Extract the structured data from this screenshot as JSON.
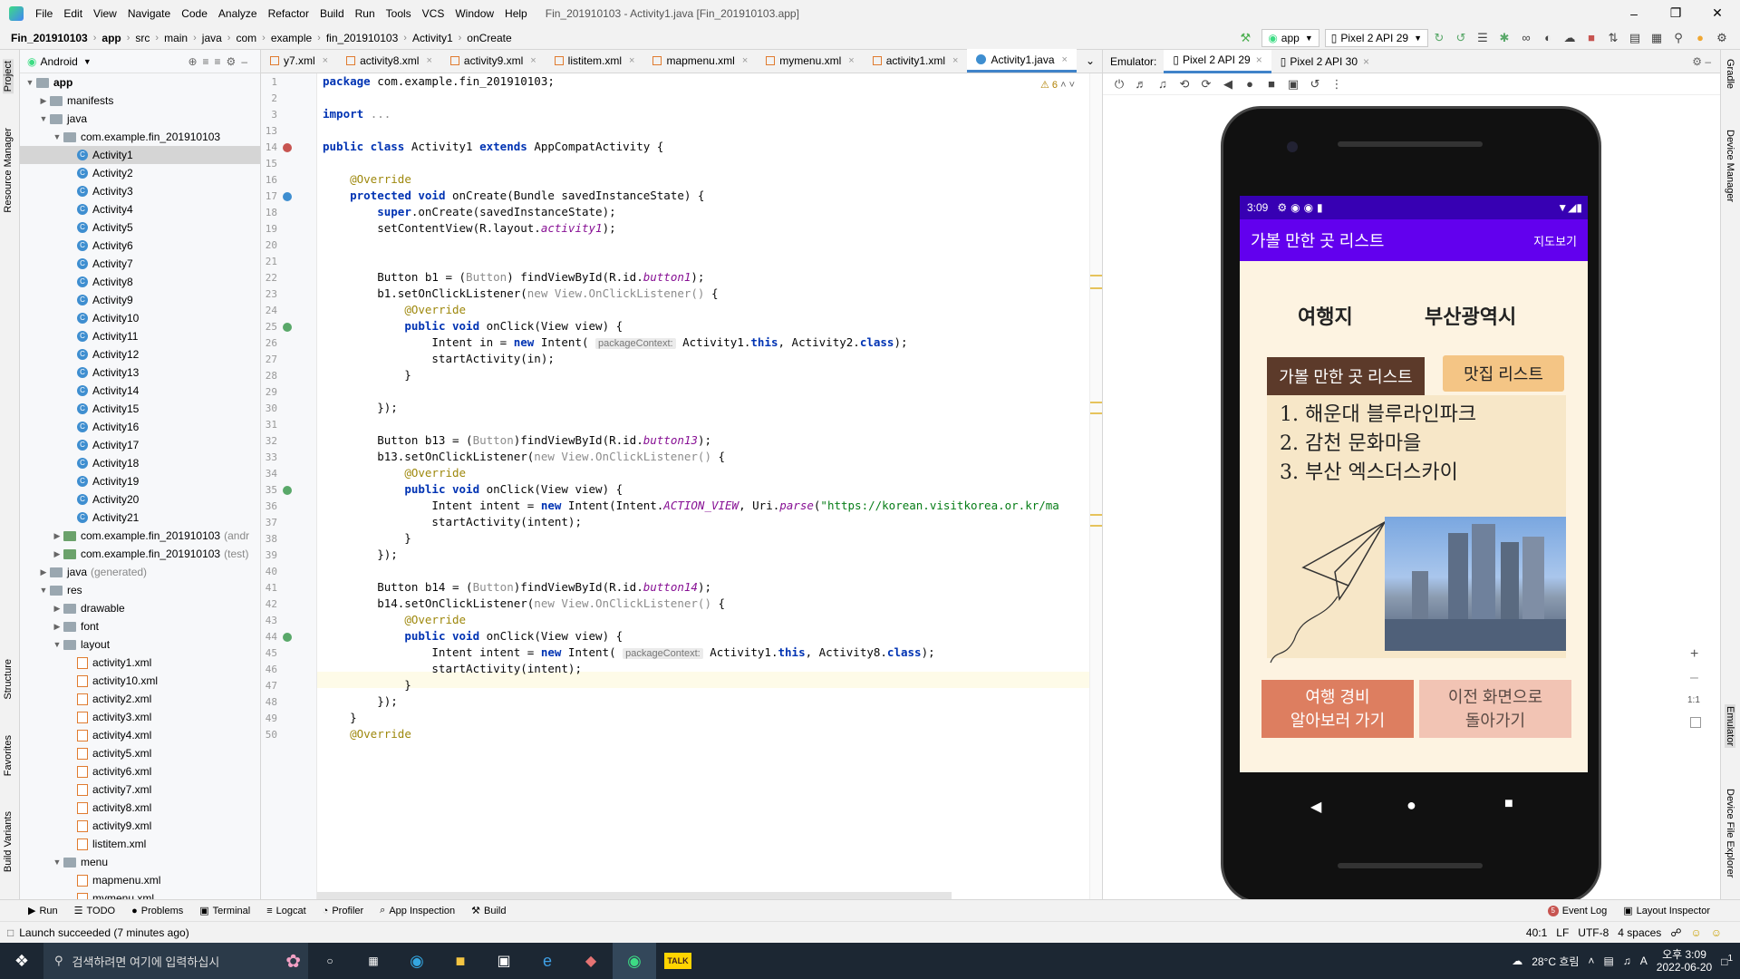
{
  "menubar": {
    "items": [
      "File",
      "Edit",
      "View",
      "Navigate",
      "Code",
      "Analyze",
      "Refactor",
      "Build",
      "Run",
      "Tools",
      "VCS",
      "Window",
      "Help"
    ],
    "title": "Fin_201910103 - Activity1.java [Fin_201910103.app]"
  },
  "navbar": {
    "crumbs": [
      "Fin_201910103",
      "app",
      "src",
      "main",
      "java",
      "com",
      "example",
      "fin_201910103",
      "Activity1",
      "onCreate"
    ],
    "run_config": "app",
    "device": "Pixel 2 API 29"
  },
  "left_strip": {
    "project": "Project",
    "resource_manager": "Resource Manager",
    "structure": "Structure",
    "favorites": "Favorites",
    "build_variants": "Build Variants"
  },
  "right_strip": {
    "gradle": "Gradle",
    "device_manager": "Device Manager",
    "emulator": "Emulator",
    "device_file_explorer": "Device File Explorer"
  },
  "project": {
    "view_mode": "Android",
    "tree": [
      {
        "label": "app",
        "depth": 0,
        "type": "folder",
        "open": true,
        "bold": true
      },
      {
        "label": "manifests",
        "depth": 1,
        "type": "folder"
      },
      {
        "label": "java",
        "depth": 1,
        "type": "folder",
        "open": true
      },
      {
        "label": "com.example.fin_201910103",
        "depth": 2,
        "type": "folder",
        "open": true
      },
      {
        "label": "Activity1",
        "depth": 3,
        "type": "class",
        "selected": true
      },
      {
        "label": "Activity2",
        "depth": 3,
        "type": "class"
      },
      {
        "label": "Activity3",
        "depth": 3,
        "type": "class"
      },
      {
        "label": "Activity4",
        "depth": 3,
        "type": "class"
      },
      {
        "label": "Activity5",
        "depth": 3,
        "type": "class"
      },
      {
        "label": "Activity6",
        "depth": 3,
        "type": "class"
      },
      {
        "label": "Activity7",
        "depth": 3,
        "type": "class"
      },
      {
        "label": "Activity8",
        "depth": 3,
        "type": "class"
      },
      {
        "label": "Activity9",
        "depth": 3,
        "type": "class"
      },
      {
        "label": "Activity10",
        "depth": 3,
        "type": "class"
      },
      {
        "label": "Activity11",
        "depth": 3,
        "type": "class"
      },
      {
        "label": "Activity12",
        "depth": 3,
        "type": "class"
      },
      {
        "label": "Activity13",
        "depth": 3,
        "type": "class"
      },
      {
        "label": "Activity14",
        "depth": 3,
        "type": "class"
      },
      {
        "label": "Activity15",
        "depth": 3,
        "type": "class"
      },
      {
        "label": "Activity16",
        "depth": 3,
        "type": "class"
      },
      {
        "label": "Activity17",
        "depth": 3,
        "type": "class"
      },
      {
        "label": "Activity18",
        "depth": 3,
        "type": "class"
      },
      {
        "label": "Activity19",
        "depth": 3,
        "type": "class"
      },
      {
        "label": "Activity20",
        "depth": 3,
        "type": "class"
      },
      {
        "label": "Activity21",
        "depth": 3,
        "type": "class"
      },
      {
        "label": "com.example.fin_201910103",
        "suffix": "(andr",
        "depth": 2,
        "type": "folder",
        "green": true
      },
      {
        "label": "com.example.fin_201910103",
        "suffix": "(test)",
        "depth": 2,
        "type": "folder",
        "green": true
      },
      {
        "label": "java",
        "suffix": "(generated)",
        "depth": 1,
        "type": "folder"
      },
      {
        "label": "res",
        "depth": 1,
        "type": "folder",
        "open": true
      },
      {
        "label": "drawable",
        "depth": 2,
        "type": "folder"
      },
      {
        "label": "font",
        "depth": 2,
        "type": "folder"
      },
      {
        "label": "layout",
        "depth": 2,
        "type": "folder",
        "open": true
      },
      {
        "label": "activity1.xml",
        "depth": 3,
        "type": "xml"
      },
      {
        "label": "activity10.xml",
        "depth": 3,
        "type": "xml"
      },
      {
        "label": "activity2.xml",
        "depth": 3,
        "type": "xml"
      },
      {
        "label": "activity3.xml",
        "depth": 3,
        "type": "xml"
      },
      {
        "label": "activity4.xml",
        "depth": 3,
        "type": "xml"
      },
      {
        "label": "activity5.xml",
        "depth": 3,
        "type": "xml"
      },
      {
        "label": "activity6.xml",
        "depth": 3,
        "type": "xml"
      },
      {
        "label": "activity7.xml",
        "depth": 3,
        "type": "xml"
      },
      {
        "label": "activity8.xml",
        "depth": 3,
        "type": "xml"
      },
      {
        "label": "activity9.xml",
        "depth": 3,
        "type": "xml"
      },
      {
        "label": "listitem.xml",
        "depth": 3,
        "type": "xml"
      },
      {
        "label": "menu",
        "depth": 2,
        "type": "folder",
        "open": true
      },
      {
        "label": "mapmenu.xml",
        "depth": 3,
        "type": "xml"
      },
      {
        "label": "mymenu.xml",
        "depth": 3,
        "type": "xml"
      }
    ]
  },
  "editor": {
    "tabs": [
      {
        "label": "y7.xml",
        "kind": "xml"
      },
      {
        "label": "activity8.xml",
        "kind": "xml"
      },
      {
        "label": "activity9.xml",
        "kind": "xml"
      },
      {
        "label": "listitem.xml",
        "kind": "xml"
      },
      {
        "label": "mapmenu.xml",
        "kind": "xml"
      },
      {
        "label": "mymenu.xml",
        "kind": "xml"
      },
      {
        "label": "activity1.xml",
        "kind": "xml"
      },
      {
        "label": "Activity1.java",
        "kind": "java",
        "active": true
      }
    ],
    "warnings": "6",
    "lines": [
      {
        "n": "1",
        "html": "<span class='kw'>package</span> com.example.fin_201910103;"
      },
      {
        "n": "2",
        "html": ""
      },
      {
        "n": "3",
        "html": "<span class='kw'>import</span> <span class='grey'>...</span>"
      },
      {
        "n": "13",
        "html": ""
      },
      {
        "n": "14",
        "html": "<span class='kw'>public class</span> Activity1 <span class='kw'>extends</span> AppCompatActivity {"
      },
      {
        "n": "15",
        "html": ""
      },
      {
        "n": "16",
        "html": "    <span class='ann'>@Override</span>"
      },
      {
        "n": "17",
        "html": "    <span class='kw'>protected void</span> onCreate(Bundle savedInstanceState) {"
      },
      {
        "n": "18",
        "html": "        <span class='kw'>super</span>.onCreate(savedInstanceState);"
      },
      {
        "n": "19",
        "html": "        setContentView(R.layout.<span class='it'>activity1</span>);"
      },
      {
        "n": "20",
        "html": ""
      },
      {
        "n": "21",
        "html": ""
      },
      {
        "n": "22",
        "html": "        Button b1 = (<span class='grey'>Button</span>) findViewById(R.id.<span class='it'>button1</span>);"
      },
      {
        "n": "23",
        "html": "        b1.setOnClickListener(<span class='grey'>new View.OnClickListener()</span> {"
      },
      {
        "n": "24",
        "html": "            <span class='ann'>@Override</span>"
      },
      {
        "n": "25",
        "html": "            <span class='kw'>public void</span> onClick(View view) {"
      },
      {
        "n": "26",
        "html": "                Intent in = <span class='kw'>new</span> Intent( <span class='hint'>packageContext:</span> Activity1.<span class='kw'>this</span>, Activity2.<span class='kw'>class</span>);"
      },
      {
        "n": "27",
        "html": "                startActivity(in);"
      },
      {
        "n": "28",
        "html": "            }"
      },
      {
        "n": "29",
        "html": ""
      },
      {
        "n": "30",
        "html": "        });"
      },
      {
        "n": "31",
        "html": ""
      },
      {
        "n": "32",
        "html": "        Button b13 = (<span class='grey'>Button</span>)findViewById(R.id.<span class='it'>button13</span>);"
      },
      {
        "n": "33",
        "html": "        b13.setOnClickListener(<span class='grey'>new View.OnClickListener()</span> {"
      },
      {
        "n": "34",
        "html": "            <span class='ann'>@Override</span>"
      },
      {
        "n": "35",
        "html": "            <span class='kw'>public void</span> onClick(View view) {"
      },
      {
        "n": "36",
        "html": "                Intent intent = <span class='kw'>new</span> Intent(Intent.<span class='it'>ACTION_VIEW</span>, Uri.<span class='it'>parse</span>(<span class='str'>\"https://korean.visitkorea.or.kr/ma</span>"
      },
      {
        "n": "37",
        "html": "                startActivity(intent);"
      },
      {
        "n": "38",
        "html": "            }"
      },
      {
        "n": "39",
        "html": "        });"
      },
      {
        "n": "40",
        "html": ""
      },
      {
        "n": "41",
        "html": "        Button b14 = (<span class='grey'>Button</span>)findViewById(R.id.<span class='it'>button14</span>);"
      },
      {
        "n": "42",
        "html": "        b14.setOnClickListener(<span class='grey'>new View.OnClickListener()</span> {"
      },
      {
        "n": "43",
        "html": "            <span class='ann'>@Override</span>"
      },
      {
        "n": "44",
        "html": "            <span class='kw'>public void</span> onClick(View view) {"
      },
      {
        "n": "45",
        "html": "                Intent intent = <span class='kw'>new</span> Intent( <span class='hint'>packageContext:</span> Activity1.<span class='kw'>this</span>, Activity8.<span class='kw'>class</span>);"
      },
      {
        "n": "46",
        "html": "                startActivity(intent);"
      },
      {
        "n": "47",
        "html": "            }"
      },
      {
        "n": "48",
        "html": "        });"
      },
      {
        "n": "49",
        "html": "    }"
      },
      {
        "n": "50",
        "html": "    <span class='ann'>@Override</span>"
      }
    ]
  },
  "emulator": {
    "label": "Emulator:",
    "tabs": [
      "Pixel 2 API 29",
      "Pixel 2 API 30"
    ],
    "phone": {
      "time": "3:09",
      "app_title": "가볼 만한 곳 리스트",
      "menu_action": "지도보기",
      "label_place": "여행지",
      "value_place": "부산광역시",
      "tab_active": "가볼 만한 곳 리스트",
      "tab_inactive": "맛집 리스트",
      "list": [
        "1. 해운대 블루라인파크",
        "2. 감천 문화마을",
        "3. 부산 엑스더스카이"
      ],
      "btn_cost": "여행 경비\n알아보러 가기",
      "btn_back": "이전 화면으로\n돌아가기"
    },
    "zoom": "1:1"
  },
  "bottom_tools": [
    "Run",
    "TODO",
    "Problems",
    "Terminal",
    "Logcat",
    "Profiler",
    "App Inspection",
    "Build"
  ],
  "bottom_right": [
    "Event Log",
    "Layout Inspector"
  ],
  "event_count": "5",
  "status": {
    "message": "Launch succeeded (7 minutes ago)",
    "position": "40:1",
    "line_sep": "LF",
    "encoding": "UTF-8",
    "indent": "4 spaces"
  },
  "taskbar": {
    "search_placeholder": "검색하려면 여기에 입력하십시",
    "weather": "28°C  흐림",
    "time": "오후 3:09",
    "date": "2022-06-20",
    "ime_lang": "A",
    "notif": "1"
  }
}
